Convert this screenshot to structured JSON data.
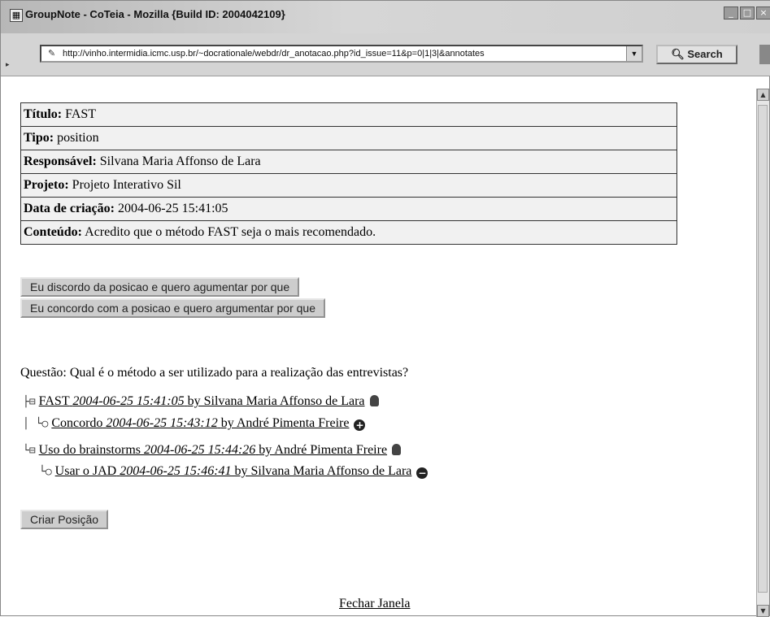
{
  "window": {
    "title": "GroupNote - CoTeia - Mozilla {Build ID: 2004042109}"
  },
  "toolbar": {
    "url": "http://vinho.intermidia.icmc.usp.br/~docrationale/webdr/dr_anotacao.php?id_issue=11&p=0|1|3|&annotates",
    "search_label": "Search"
  },
  "info": {
    "rows": [
      {
        "label": "Título:",
        "value": "FAST"
      },
      {
        "label": "Tipo:",
        "value": "position"
      },
      {
        "label": "Responsável:",
        "value": "Silvana Maria Affonso de Lara"
      },
      {
        "label": "Projeto:",
        "value": "Projeto Interativo Sil"
      },
      {
        "label": "Data de criação:",
        "value": "2004-06-25 15:41:05"
      },
      {
        "label": "Conteúdo:",
        "value": "Acredito que o método FAST seja o mais recomendado."
      }
    ]
  },
  "buttons": {
    "disagree": "Eu discordo da posicao e quero agumentar por que",
    "agree": "Eu concordo com a posicao e quero argumentar por que",
    "create_position": "Criar Posição"
  },
  "question": "Questão: Qual é o método a ser utilizado para a realização das entrevistas?",
  "tree": {
    "fast": {
      "title": "FAST",
      "date": "2004-06-25 15:41:05",
      "author": "by Silvana Maria Affonso de Lara"
    },
    "concordo": {
      "title": "Concordo",
      "date": "2004-06-25 15:43:12",
      "author": "by André Pimenta Freire"
    },
    "brainstorms": {
      "title": "Uso do brainstorms",
      "date": "2004-06-25 15:44:26",
      "author": "by André Pimenta Freire"
    },
    "jad": {
      "title": "Usar o JAD",
      "date": "2004-06-25 15:46:41",
      "author": "by Silvana Maria Affonso de Lara"
    }
  },
  "close_link": "Fechar Janela",
  "icons": {
    "app": "app-window-icon",
    "url": "page-proxy-icon",
    "search": "magnifier-icon",
    "position": "lightbulb-icon",
    "agree": "plus-circle-icon",
    "disagree": "minus-circle-icon"
  }
}
